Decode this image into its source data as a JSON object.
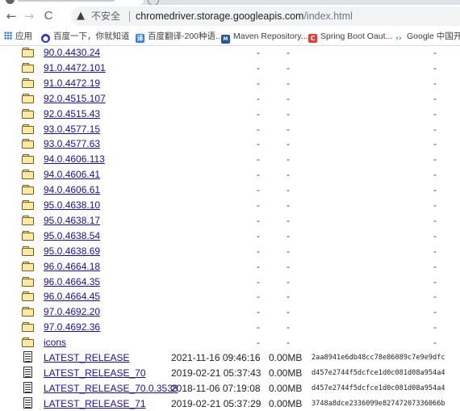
{
  "browser": {
    "nav": {
      "back": "←",
      "forward": "→",
      "reload": "C"
    },
    "omnibox": {
      "warning_icon": "warning-triangle-icon",
      "security_label": "不安全",
      "url_host": "chromedriver.storage.googleapis.com",
      "url_path": "/index.html"
    },
    "bookmarks": [
      {
        "label": "应用",
        "icon": "apps-grid-icon"
      },
      {
        "label": "百度一下，你就知道",
        "icon": "baidu-paw-icon",
        "color": "#2932e1"
      },
      {
        "label": "百度翻译-200种语...",
        "icon": "baidu-translate-icon",
        "color": "#2f7cf6"
      },
      {
        "label": "Maven Repository...",
        "icon": "maven-icon",
        "color": "#2b5797"
      },
      {
        "label": "Spring Boot Oaut...",
        "icon": "csdn-c-icon",
        "color": "#e33e33"
      },
      {
        "label": "Google 中国开发",
        "icon": "google-dev-icon",
        "color": "#1a73e8"
      }
    ]
  },
  "listing": {
    "folders": [
      {
        "name": "90.0.4430.24",
        "date": "-",
        "size": "-",
        "etag": "-"
      },
      {
        "name": "91.0.4472.101",
        "date": "-",
        "size": "-",
        "etag": "-"
      },
      {
        "name": "91.0.4472.19",
        "date": "-",
        "size": "-",
        "etag": "-"
      },
      {
        "name": "92.0.4515.107",
        "date": "-",
        "size": "-",
        "etag": "-"
      },
      {
        "name": "92.0.4515.43",
        "date": "-",
        "size": "-",
        "etag": "-"
      },
      {
        "name": "93.0.4577.15",
        "date": "-",
        "size": "-",
        "etag": "-"
      },
      {
        "name": "93.0.4577.63",
        "date": "-",
        "size": "-",
        "etag": "-"
      },
      {
        "name": "94.0.4606.113",
        "date": "-",
        "size": "-",
        "etag": "-"
      },
      {
        "name": "94.0.4606.41",
        "date": "-",
        "size": "-",
        "etag": "-"
      },
      {
        "name": "94.0.4606.61",
        "date": "-",
        "size": "-",
        "etag": "-"
      },
      {
        "name": "95.0.4638.10",
        "date": "-",
        "size": "-",
        "etag": "-"
      },
      {
        "name": "95.0.4638.17",
        "date": "-",
        "size": "-",
        "etag": "-"
      },
      {
        "name": "95.0.4638.54",
        "date": "-",
        "size": "-",
        "etag": "-"
      },
      {
        "name": "95.0.4638.69",
        "date": "-",
        "size": "-",
        "etag": "-"
      },
      {
        "name": "96.0.4664.18",
        "date": "-",
        "size": "-",
        "etag": "-"
      },
      {
        "name": "96.0.4664.35",
        "date": "-",
        "size": "-",
        "etag": "-"
      },
      {
        "name": "96.0.4664.45",
        "date": "-",
        "size": "-",
        "etag": "-"
      },
      {
        "name": "97.0.4692.20",
        "date": "-",
        "size": "-",
        "etag": "-"
      },
      {
        "name": "97.0.4692.36",
        "date": "-",
        "size": "-",
        "etag": "-"
      },
      {
        "name": "icons",
        "date": "-",
        "size": "-",
        "etag": "-"
      }
    ],
    "files": [
      {
        "name": "LATEST_RELEASE",
        "date": "2021-11-16 09:46:16",
        "size": "0.00MB",
        "etag": "2aa8941e6db48cc78e86089c7e9e9dfc"
      },
      {
        "name": "LATEST_RELEASE_70",
        "date": "2019-02-21 05:37:43",
        "size": "0.00MB",
        "etag": "d457e2744f5dcfce1d0c081d08a954a4"
      },
      {
        "name": "LATEST_RELEASE_70.0.3538",
        "date": "2018-11-06 07:19:08",
        "size": "0.00MB",
        "etag": "d457e2744f5dcfce1d0c081d08a954a4"
      },
      {
        "name": "LATEST_RELEASE_71",
        "date": "2019-02-21 05:37:29",
        "size": "0.00MB",
        "etag": "3748a8dce2336099e82747207336066b"
      }
    ]
  }
}
